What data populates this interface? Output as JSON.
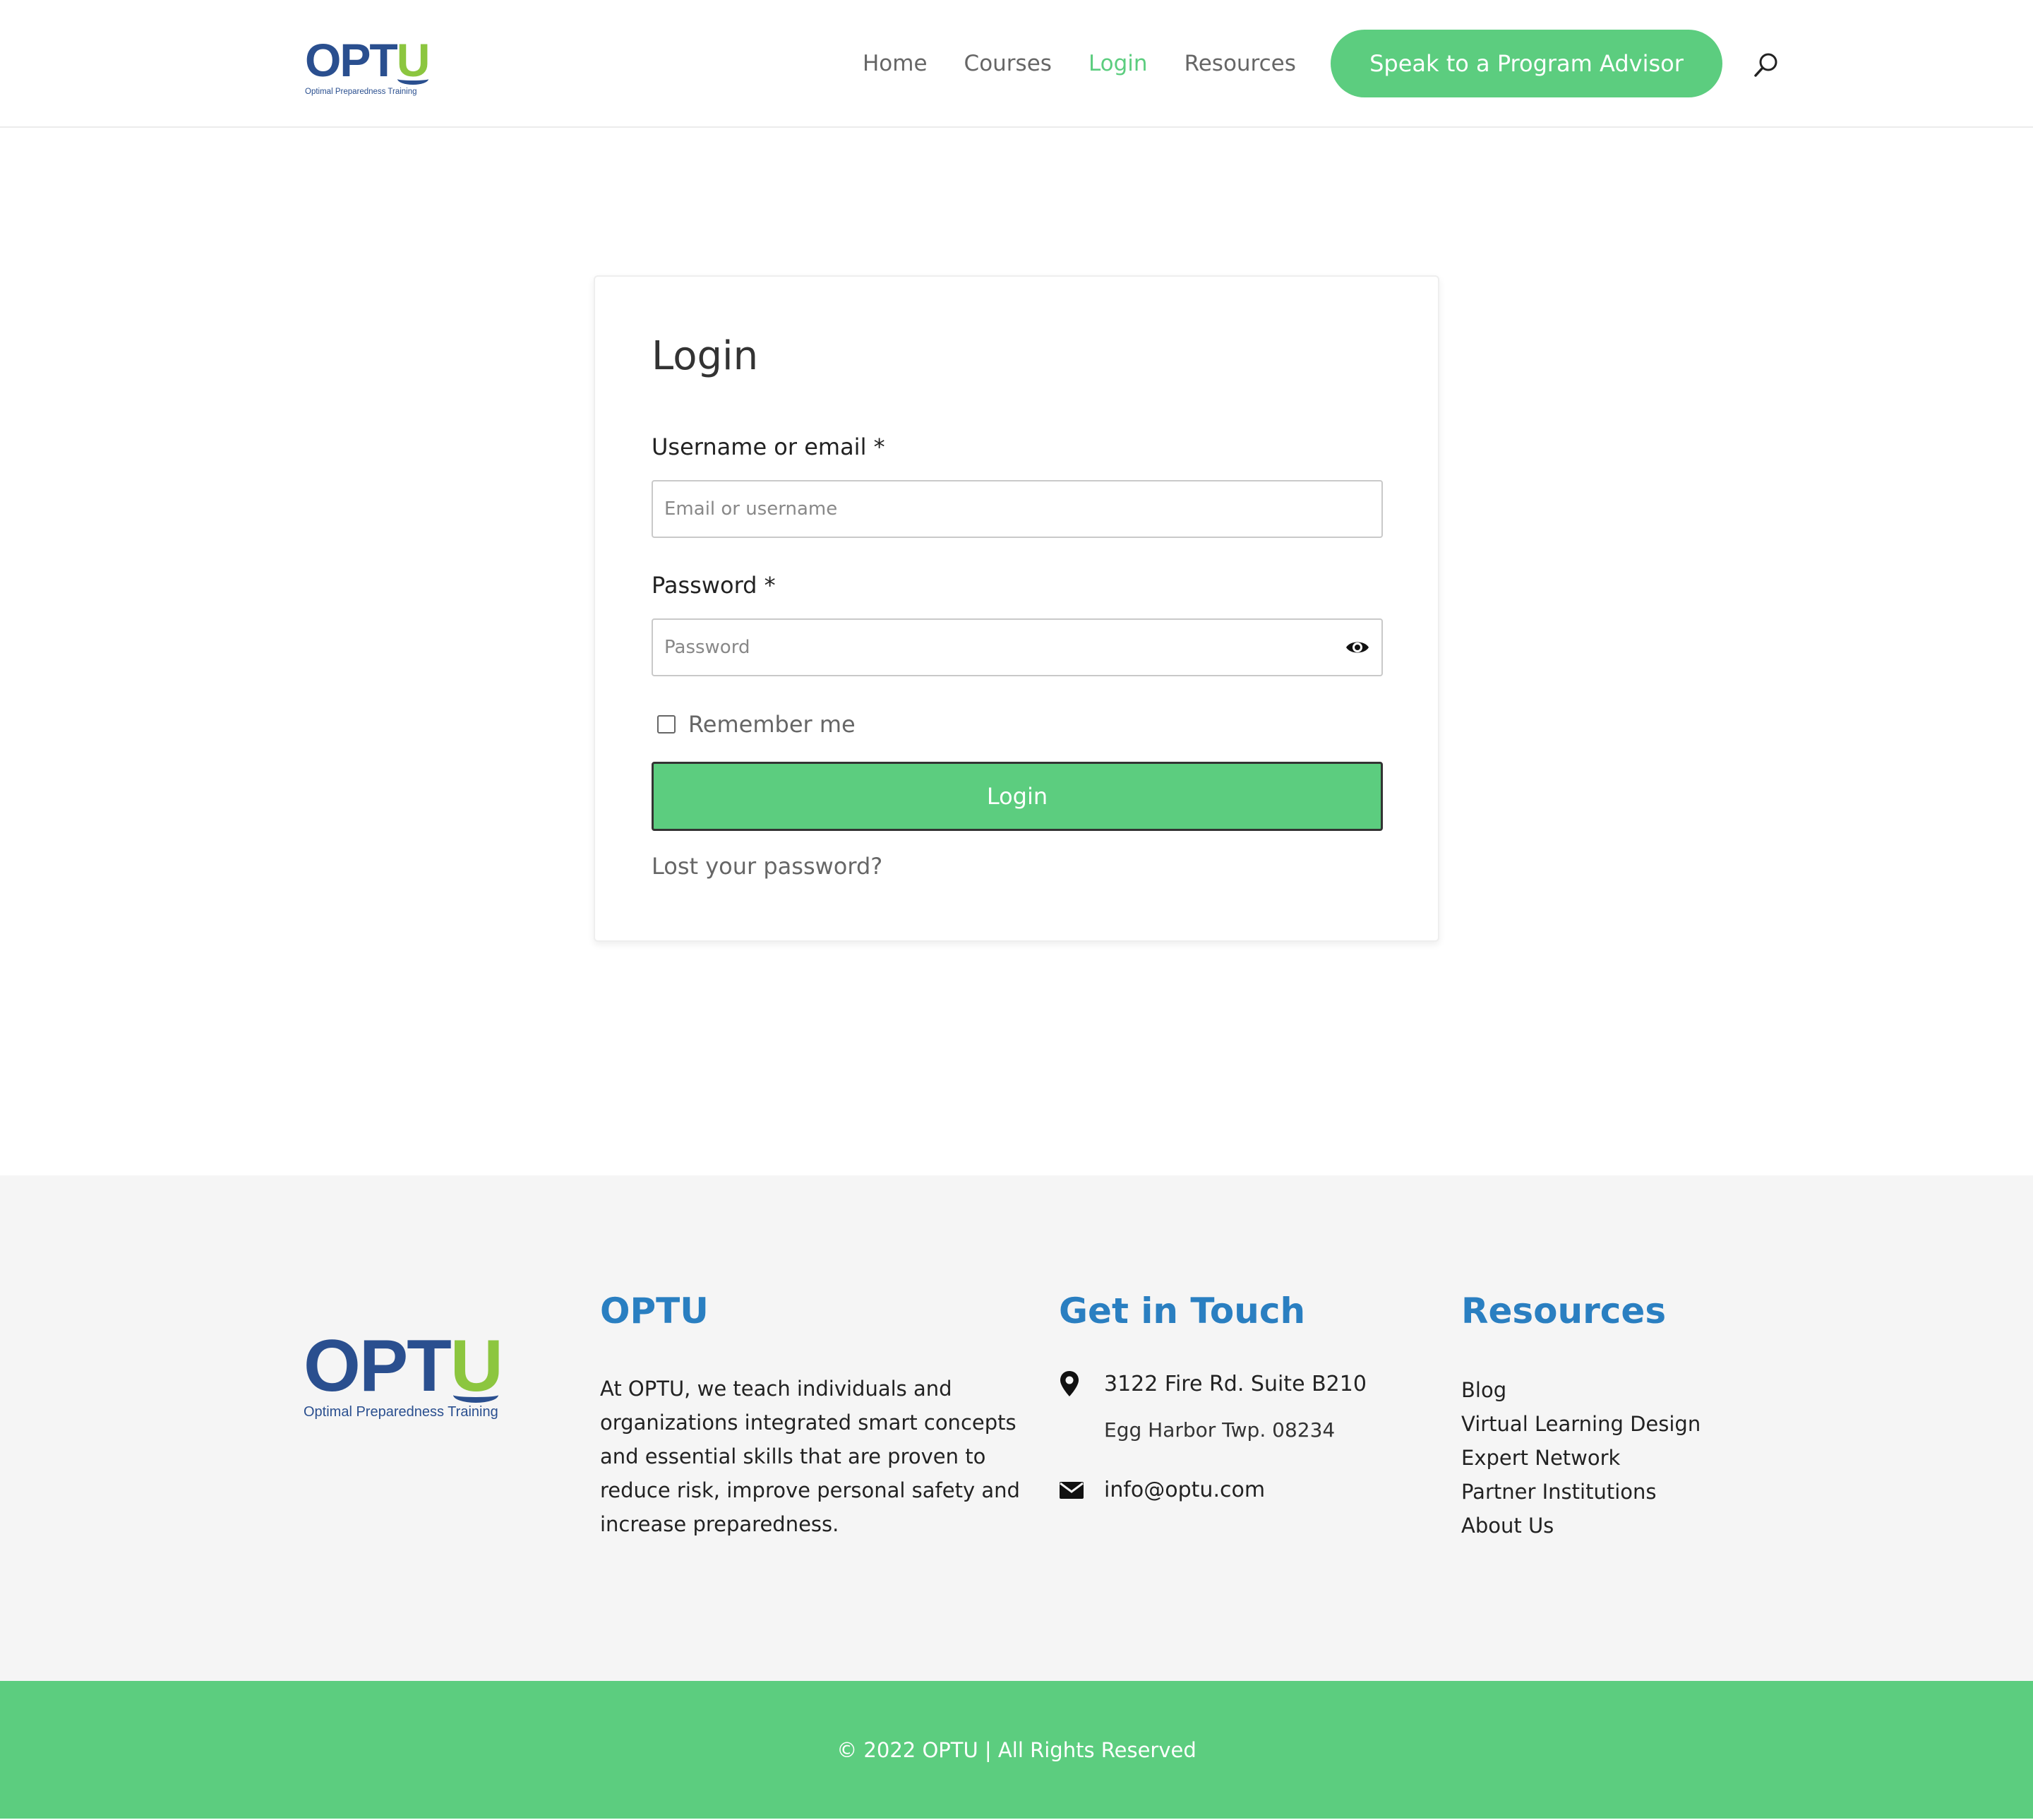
{
  "brand": {
    "logo_main": "OPT",
    "logo_accent": "U",
    "tagline": "Optimal Preparedness Training",
    "primary_color": "#2a4f8f",
    "accent_color": "#8cc63f",
    "green": "#5ccd7f",
    "heading_blue": "#2a7fc1"
  },
  "nav": {
    "items": [
      {
        "label": "Home",
        "active": false
      },
      {
        "label": "Courses",
        "active": false
      },
      {
        "label": "Login",
        "active": true
      },
      {
        "label": "Resources",
        "active": false
      }
    ],
    "cta_label": "Speak to a Program Advisor",
    "search_icon": "search-icon"
  },
  "login_form": {
    "title": "Login",
    "username_label": "Username or email *",
    "username_placeholder": "Email or username",
    "username_value": "",
    "password_label": "Password *",
    "password_placeholder": "Password",
    "password_value": "",
    "show_password_icon": "eye-icon",
    "remember_label": "Remember me",
    "remember_checked": false,
    "submit_label": "Login",
    "lost_password_label": "Lost your password?"
  },
  "footer": {
    "about": {
      "title": "OPTU",
      "text": "At OPTU, we teach individuals and organizations integrated smart concepts and essential skills that are proven to reduce risk, improve personal safety and increase preparedness."
    },
    "contact": {
      "title": "Get in Touch",
      "address_line1": "3122 Fire Rd. Suite B210",
      "address_line2": "Egg Harbor Twp. 08234",
      "email": "info@optu.com",
      "address_icon": "map-pin-icon",
      "email_icon": "envelope-icon"
    },
    "resources": {
      "title": "Resources",
      "links": [
        "Blog",
        "Virtual Learning Design",
        "Expert Network",
        "Partner Institutions",
        "About Us"
      ]
    }
  },
  "copyright": "© 2022 OPTU | All Rights Reserved"
}
